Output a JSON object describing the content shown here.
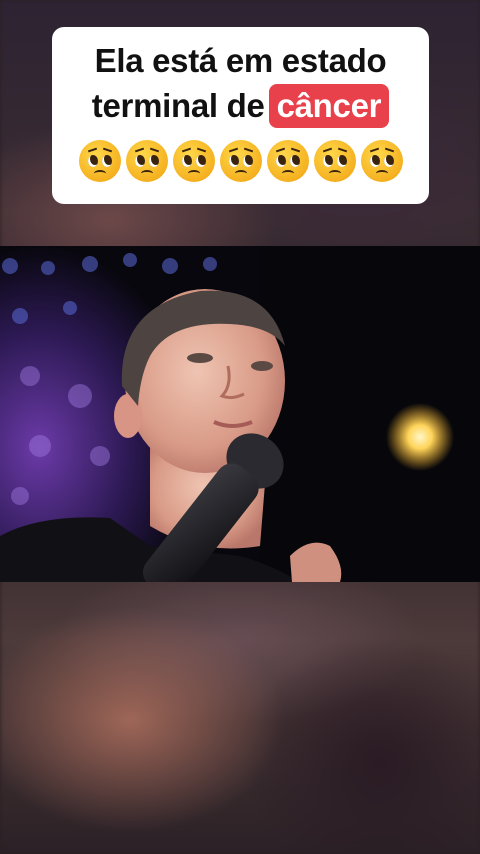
{
  "caption": {
    "line1": "Ela está em estado",
    "line2_prefix": "terminal de",
    "highlight": "câncer",
    "emoji_count": 7,
    "emoji": "pleading-face-icon",
    "highlight_color": "#e8414b"
  }
}
